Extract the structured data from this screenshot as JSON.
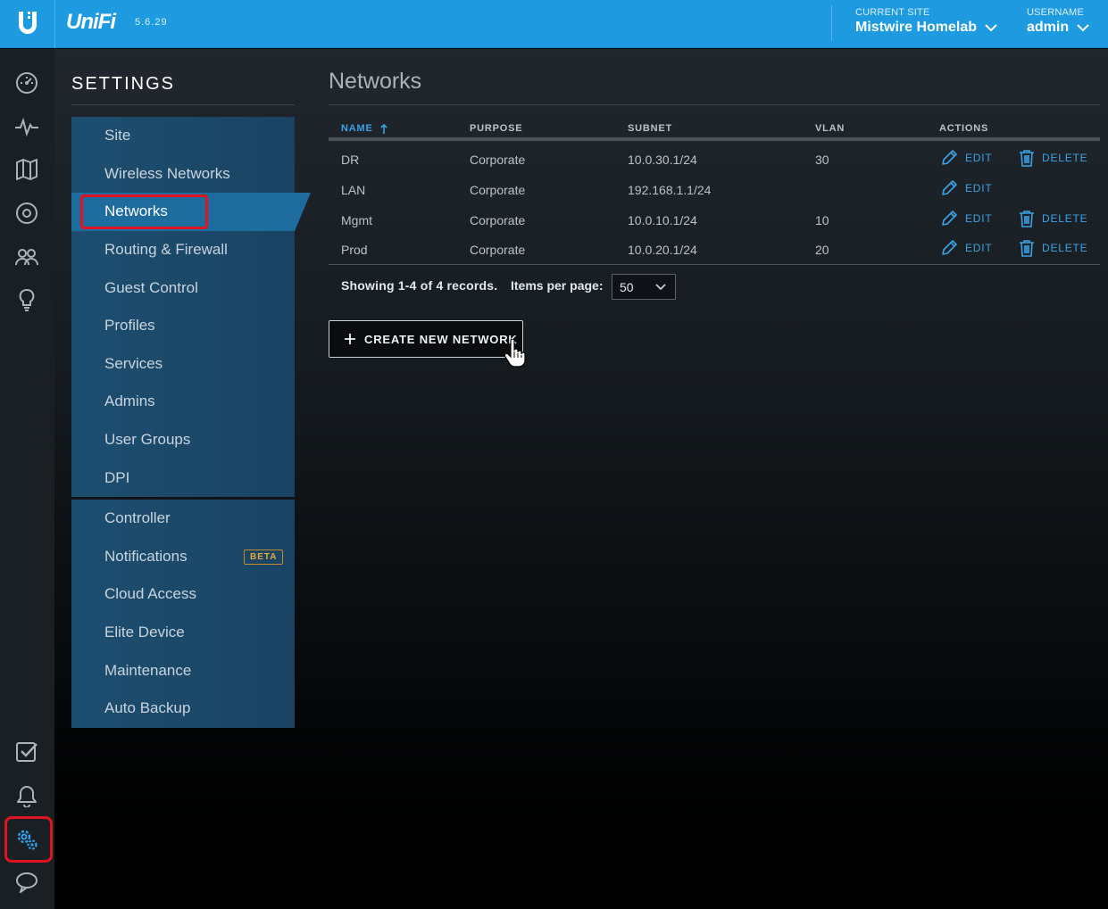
{
  "header": {
    "brand": "UniFi",
    "version": "5.6.29",
    "current_site_caption": "CURRENT SITE",
    "current_site": "Mistwire Homelab",
    "username_caption": "USERNAME",
    "username": "admin",
    "brand_color": "#1e9be0"
  },
  "rail": {
    "icons": [
      "dashboard-icon",
      "statistics-icon",
      "map-icon",
      "devices-icon",
      "clients-icon",
      "insights-icon",
      "events-icon",
      "alerts-icon",
      "settings-icon",
      "chat-icon"
    ],
    "selected": "settings-icon"
  },
  "settings": {
    "title": "SETTINGS",
    "groups": [
      [
        {
          "label": "Site"
        },
        {
          "label": "Wireless Networks"
        },
        {
          "label": "Networks",
          "active": true
        },
        {
          "label": "Routing & Firewall"
        },
        {
          "label": "Guest Control"
        },
        {
          "label": "Profiles"
        },
        {
          "label": "Services"
        },
        {
          "label": "Admins"
        },
        {
          "label": "User Groups"
        },
        {
          "label": "DPI"
        }
      ],
      [
        {
          "label": "Controller"
        },
        {
          "label": "Notifications",
          "badge": "BETA"
        },
        {
          "label": "Cloud Access"
        },
        {
          "label": "Elite Device"
        },
        {
          "label": "Maintenance"
        },
        {
          "label": "Auto Backup"
        }
      ]
    ]
  },
  "networks": {
    "title": "Networks",
    "columns": {
      "name": "NAME",
      "purpose": "PURPOSE",
      "subnet": "SUBNET",
      "vlan": "VLAN",
      "actions": "ACTIONS"
    },
    "sort_icon": "arrow-up-icon",
    "edit_label": "EDIT",
    "delete_label": "DELETE",
    "rows": [
      {
        "name": "DR",
        "purpose": "Corporate",
        "subnet": "10.0.30.1/24",
        "vlan": "30",
        "can_delete": true
      },
      {
        "name": "LAN",
        "purpose": "Corporate",
        "subnet": "192.168.1.1/24",
        "vlan": "",
        "can_delete": false
      },
      {
        "name": "Mgmt",
        "purpose": "Corporate",
        "subnet": "10.0.10.1/24",
        "vlan": "10",
        "can_delete": true
      },
      {
        "name": "Prod",
        "purpose": "Corporate",
        "subnet": "10.0.20.1/24",
        "vlan": "20",
        "can_delete": true
      }
    ],
    "showing": "Showing 1-4 of 4 records.",
    "items_per_page_label": "Items per page:",
    "items_per_page": "50",
    "create_label": "CREATE NEW NETWORK",
    "accent": "#3aa3e6"
  }
}
